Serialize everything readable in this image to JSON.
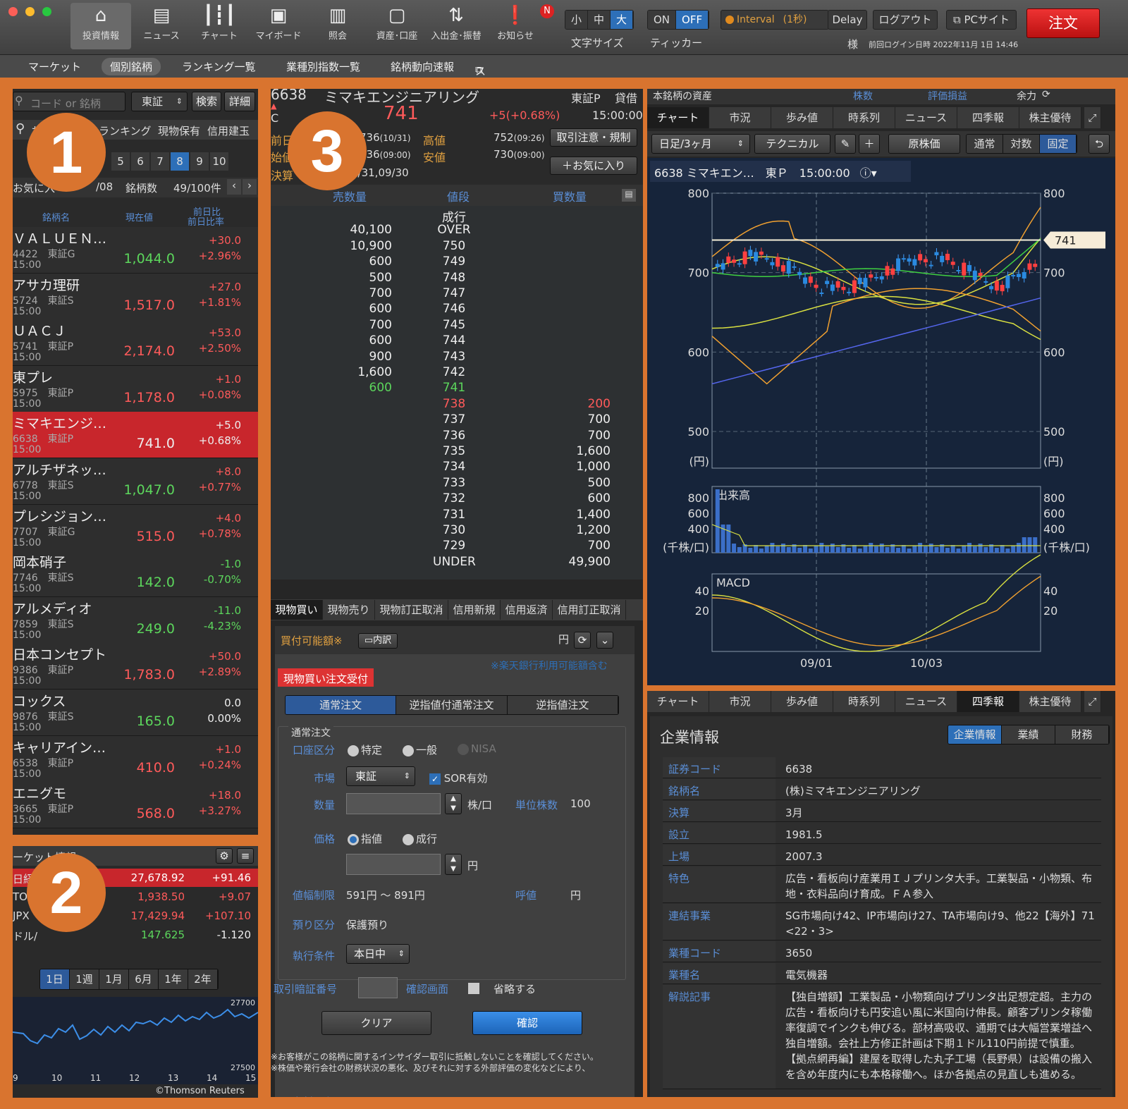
{
  "toolbar": {
    "items": [
      {
        "icon": "home-icon",
        "label": "投資情報"
      },
      {
        "icon": "newspaper-icon",
        "label": "ニュース"
      },
      {
        "icon": "candlestick-icon",
        "label": "チャート"
      },
      {
        "icon": "my-board-icon",
        "label": "マイボード"
      },
      {
        "icon": "book-icon",
        "label": "照会"
      },
      {
        "icon": "safe-icon",
        "label": "資産･口座"
      },
      {
        "icon": "transfer-icon",
        "label": "入出金･振替"
      },
      {
        "icon": "notice-icon",
        "label": "お知らせ"
      }
    ],
    "notice_badge": "N",
    "font_size": {
      "options": [
        "小",
        "中",
        "大"
      ],
      "selected": "大",
      "label": "文字サイズ"
    },
    "ticker": {
      "on": "ON",
      "off": "OFF",
      "label": "ティッカー"
    },
    "interval": "Interval",
    "interval_sec": "(1秒)",
    "delay": "Delay",
    "logout": "ログアウト",
    "pc_site": "PCサイト",
    "order": "注文",
    "user_suffix": "様",
    "last_login": "前回ログイン日時 2022年11月 1日 14:46"
  },
  "subnav": [
    "マーケット",
    "個別銘柄",
    "ランキング一覧",
    "業種別指数一覧",
    "銘柄動向速報",
    "スクリーニング"
  ],
  "subnav_active": "個別銘柄",
  "badges": [
    "1",
    "2",
    "3"
  ],
  "left": {
    "search_placeholder": "コード or 銘柄",
    "market": "東証",
    "search_btn": "検索",
    "detail_btn": "詳細",
    "tabs": [
      "お",
      "ランキング",
      "現物保有",
      "信用建玉"
    ],
    "pages": [
      "5",
      "6",
      "7",
      "8",
      "9",
      "10"
    ],
    "page_active": "8",
    "fav_label": "お気に入",
    "fav_date": "/08",
    "count_label": "銘柄数",
    "count": "49/100件",
    "col_name": "銘柄名",
    "col_price": "現在値",
    "col_change": "前日比",
    "col_pct": "前日比率",
    "rows": [
      {
        "name": "ＶＡＬＵＥＮ…",
        "code": "4422",
        "mkt": "東証G",
        "time": "15:00",
        "price": "1,044.0",
        "chg": "+30.0",
        "pct": "+2.96%",
        "dir": "dn",
        "cdir": "up"
      },
      {
        "name": "アサカ理研",
        "code": "5724",
        "mkt": "東証S",
        "time": "15:00",
        "price": "1,517.0",
        "chg": "+27.0",
        "pct": "+1.81%",
        "dir": "up",
        "cdir": "up"
      },
      {
        "name": "ＵＡＣＪ",
        "code": "5741",
        "mkt": "東証P",
        "time": "15:00",
        "price": "2,174.0",
        "chg": "+53.0",
        "pct": "+2.50%",
        "dir": "up",
        "cdir": "up"
      },
      {
        "name": "東プレ",
        "code": "5975",
        "mkt": "東証P",
        "time": "15:00",
        "price": "1,178.0",
        "chg": "+1.0",
        "pct": "+0.08%",
        "dir": "up",
        "cdir": "up"
      },
      {
        "name": "ミマキエンジ…",
        "code": "6638",
        "mkt": "東証P",
        "time": "15:00",
        "price": "741.0",
        "chg": "+5.0",
        "pct": "+0.68%",
        "dir": "wt",
        "cdir": "up",
        "selected": true
      },
      {
        "name": "アルチザネッ…",
        "code": "6778",
        "mkt": "東証S",
        "time": "15:00",
        "price": "1,047.0",
        "chg": "+8.0",
        "pct": "+0.77%",
        "dir": "dn",
        "cdir": "up"
      },
      {
        "name": "プレシジョン…",
        "code": "7707",
        "mkt": "東証G",
        "time": "15:00",
        "price": "515.0",
        "chg": "+4.0",
        "pct": "+0.78%",
        "dir": "up",
        "cdir": "up"
      },
      {
        "name": "岡本硝子",
        "code": "7746",
        "mkt": "東証S",
        "time": "15:00",
        "price": "142.0",
        "chg": "-1.0",
        "pct": "-0.70%",
        "dir": "dn",
        "cdir": "dn"
      },
      {
        "name": "アルメディオ",
        "code": "7859",
        "mkt": "東証S",
        "time": "15:00",
        "price": "249.0",
        "chg": "-11.0",
        "pct": "-4.23%",
        "dir": "dn",
        "cdir": "dn"
      },
      {
        "name": "日本コンセプト",
        "code": "9386",
        "mkt": "東証P",
        "time": "15:00",
        "price": "1,783.0",
        "chg": "+50.0",
        "pct": "+2.89%",
        "dir": "up",
        "cdir": "up"
      },
      {
        "name": "コックス",
        "code": "9876",
        "mkt": "東証S",
        "time": "15:00",
        "price": "165.0",
        "chg": "0.0",
        "pct": "0.00%",
        "dir": "dn",
        "cdir": "wt"
      },
      {
        "name": "キャリアイン…",
        "code": "6538",
        "mkt": "東証P",
        "time": "15:00",
        "price": "410.0",
        "chg": "+1.0",
        "pct": "+0.24%",
        "dir": "up",
        "cdir": "up"
      },
      {
        "name": "エニグモ",
        "code": "3665",
        "mkt": "東証P",
        "time": "15:00",
        "price": "568.0",
        "chg": "+18.0",
        "pct": "+3.27%",
        "dir": "up",
        "cdir": "up"
      }
    ]
  },
  "market": {
    "title": "ーケット情報",
    "rows": [
      {
        "name": "日経2",
        "value": "27,678.92",
        "chg": "+91.46",
        "sel": true
      },
      {
        "name": "TOP",
        "value": "1,938.50",
        "chg": "+9.07"
      },
      {
        "name": "JPX",
        "value": "17,429.94",
        "chg": "+107.10"
      },
      {
        "name": "ドル/",
        "value": "147.625",
        "chg": "-1.120",
        "green": true
      }
    ],
    "ranges": [
      "1日",
      "1週",
      "1月",
      "6月",
      "1年",
      "2年"
    ],
    "range_active": "1日",
    "ymax": "27700",
    "ymin": "27500",
    "xlabels": [
      "9",
      "10",
      "11",
      "12",
      "13",
      "14",
      "15"
    ],
    "credit": "©Thomson Reuters"
  },
  "stock": {
    "code": "6638",
    "name": "ミマキエンジニアリング",
    "mkt": "東証P",
    "kashaku": "貸借",
    "grade": "C",
    "price": "741",
    "change": "+5",
    "pct": "(+0.68%)",
    "time": "15:00:00",
    "prev_label": "前日",
    "prev": "736",
    "prev_date": "(10/31)",
    "open_label": "始値",
    "open": "736",
    "open_time": "(09:00)",
    "high_label": "高値",
    "high": "752",
    "high_time": "(09:26)",
    "low_label": "安値",
    "low": "730",
    "low_time": "(09:00)",
    "settle_label": "決算",
    "settle": "3/31,09/30",
    "caution": "取引注意・規制",
    "fav": "＋お気に入り"
  },
  "board": {
    "head": [
      "売数量",
      "値段",
      "買数量"
    ],
    "rows": [
      [
        "",
        "成行",
        ""
      ],
      [
        "40,100",
        "OVER",
        ""
      ],
      [
        "10,900",
        "750",
        ""
      ],
      [
        "600",
        "749",
        ""
      ],
      [
        "500",
        "748",
        ""
      ],
      [
        "700",
        "747",
        ""
      ],
      [
        "600",
        "746",
        ""
      ],
      [
        "700",
        "745",
        ""
      ],
      [
        "600",
        "744",
        ""
      ],
      [
        "900",
        "743",
        ""
      ],
      [
        "1,600",
        "742",
        ""
      ],
      [
        "600",
        "741",
        ""
      ],
      [
        "",
        "738",
        "200"
      ],
      [
        "",
        "737",
        "700"
      ],
      [
        "",
        "736",
        "700"
      ],
      [
        "",
        "735",
        "1,600"
      ],
      [
        "",
        "734",
        "1,000"
      ],
      [
        "",
        "733",
        "500"
      ],
      [
        "",
        "732",
        "600"
      ],
      [
        "",
        "731",
        "1,400"
      ],
      [
        "",
        "730",
        "1,200"
      ],
      [
        "",
        "729",
        "700"
      ],
      [
        "",
        "UNDER",
        "49,900"
      ]
    ]
  },
  "order": {
    "tabs": [
      "現物買い",
      "現物売り",
      "現物訂正取消",
      "信用新規",
      "信用返済",
      "信用訂正取消"
    ],
    "buyable": "買付可能額※",
    "detail": "内訳",
    "yen": "円",
    "note": "※楽天銀行利用可能額含む",
    "accept": "現物買い注文受付",
    "types": [
      "通常注文",
      "逆指値付通常注文",
      "逆指値注文"
    ],
    "section": "通常注文",
    "acct_label": "口座区分",
    "acct": [
      "特定",
      "一般",
      "NISA"
    ],
    "mkt_label": "市場",
    "mkt": "東証",
    "sor": "SOR有効",
    "qty_label": "数量",
    "unit": "株/口",
    "unit_label": "単位株数",
    "unit_val": "100",
    "price_label": "価格",
    "limit": "指値",
    "market": "成行",
    "yen2": "円",
    "range_label": "値幅制限",
    "range": "591円 〜 891円",
    "tick_label": "呼値",
    "tick_unit": "円",
    "deposit_label": "預り区分",
    "deposit": "保護預り",
    "cond_label": "執行条件",
    "cond": "本日中",
    "pin_label": "取引暗証番号",
    "confirm_label": "確認画面",
    "omit": "省略する",
    "clear": "クリア",
    "confirm": "確認",
    "disc1": "※お客様がこの銘柄に関するインサイダー取引に抵触しないことを確認してください。",
    "disc2": "※株価や発行会社の財務状況の悪化、及びそれに対する外部評価の変化などにより、"
  },
  "right": {
    "asset_label": "本銘柄の資産",
    "asset_cols": [
      "株数",
      "評価損益",
      "余力"
    ],
    "tabs": [
      "チャート",
      "市況",
      "歩み値",
      "時系列",
      "ニュース",
      "四季報",
      "株主優待"
    ],
    "chart_tab_active": "チャート",
    "period": "日足/3ヶ月",
    "technical": "テクニカル",
    "genkabu": "原株価",
    "modes": [
      "通常",
      "対数",
      "固定"
    ],
    "mode_active": "固定",
    "chart_title": "6638 ミマキエン…　東Ｐ　15:00:00",
    "unit_yen": "(円)",
    "vol_label": "出来高",
    "vol_unit": "(千株/口)",
    "macd": "MACD",
    "last_tag": "741",
    "info_tab_active": "四季報"
  },
  "chart_data": {
    "type": "line",
    "price_axis": [
      800,
      700,
      600,
      500
    ],
    "volume_axis": [
      800,
      600,
      400
    ],
    "macd_axis": [
      40,
      20
    ],
    "x_ticks": [
      "09/01",
      "10/03"
    ],
    "last": 741
  },
  "company": {
    "title": "企業情報",
    "tabs": [
      "企業情報",
      "業績",
      "財務"
    ],
    "active": "企業情報",
    "rows": [
      [
        "証券コード",
        "6638"
      ],
      [
        "銘柄名",
        "(株)ミマキエンジニアリング"
      ],
      [
        "決算",
        "3月"
      ],
      [
        "設立",
        "1981.5"
      ],
      [
        "上場",
        "2007.3"
      ],
      [
        "特色",
        "広告・看板向け産業用ＩＪプリンタ大手。工業製品・小物類、布地・衣料品向け育成。ＦＡ参入"
      ],
      [
        "連結事業",
        "SG市場向け42、IP市場向け27、TA市場向け9、他22【海外】71 <22・3>"
      ],
      [
        "業種コード",
        "3650"
      ],
      [
        "業種名",
        "電気機器"
      ],
      [
        "解説記事",
        "【独自増額】工業製品・小物類向けプリンタ出足想定超。主力の広告・看板向けも円安追い風に米国向け伸長。顧客プリンタ稼働率復調でインクも伸びる。部材高吸収、通期では大幅営業増益へ独自増額。会社上方修正計画は下期１ドル110円前提で慎重。【拠点網再編】建屋を取得した丸子工場（長野県）は設備の搬入を含め年度内にも本格稼働へ。ほか各拠点の見直しも進める。"
      ]
    ]
  }
}
